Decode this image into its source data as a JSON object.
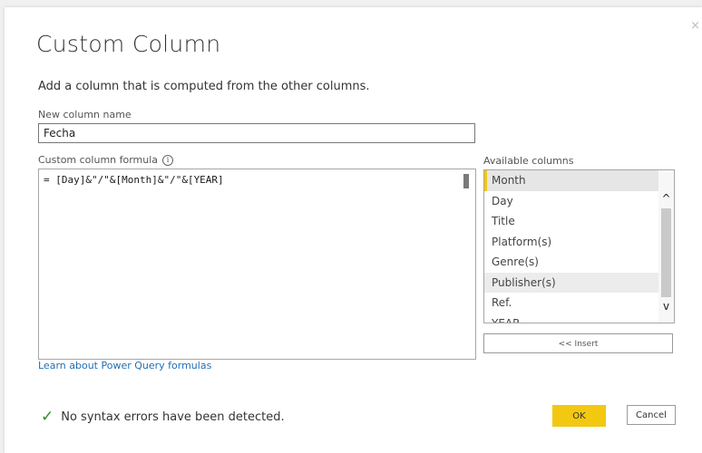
{
  "dialog": {
    "title": "Custom Column",
    "subtitle": "Add a column that is computed from the other columns.",
    "close_icon": "×"
  },
  "new_column": {
    "label": "New column name",
    "value": "Fecha"
  },
  "formula": {
    "label": "Custom column formula",
    "info_icon": "i",
    "value": "= [Day]&\"/\"&[Month]&\"/\"&[YEAR]"
  },
  "available_columns": {
    "label": "Available columns",
    "items": [
      {
        "label": "Month"
      },
      {
        "label": "Day"
      },
      {
        "label": "Title"
      },
      {
        "label": "Platform(s)"
      },
      {
        "label": "Genre(s)"
      },
      {
        "label": "Publisher(s)"
      },
      {
        "label": "Ref."
      },
      {
        "label": "YEAR"
      }
    ],
    "selected": "Month",
    "hovered": "Publisher(s)",
    "insert_label": "<< Insert",
    "scroll_up_icon": "^",
    "scroll_down_icon": "v"
  },
  "learn_link": "Learn about Power Query formulas",
  "status": {
    "check_icon": "✓",
    "message": "No syntax errors have been detected."
  },
  "buttons": {
    "ok": "OK",
    "cancel": "Cancel"
  },
  "colors": {
    "accent": "#f2c811",
    "link": "#1f6fb5",
    "success": "#2e8b2e"
  }
}
